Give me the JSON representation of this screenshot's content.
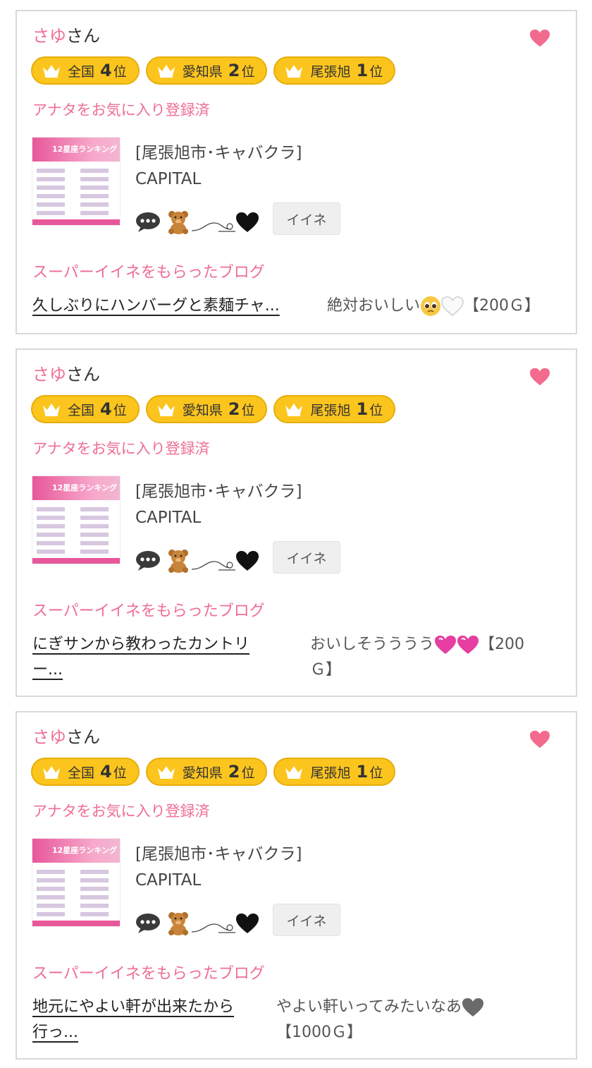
{
  "cards": [
    {
      "user_name": "さゆ",
      "honorific": "さん",
      "badges": [
        {
          "label": "全国",
          "rank": "4",
          "suffix": "位"
        },
        {
          "label": "愛知県",
          "rank": "2",
          "suffix": "位"
        },
        {
          "label": "尾張旭",
          "rank": "1",
          "suffix": "位"
        }
      ],
      "favorite_status": "アナタをお気に入り登録済",
      "thumbnail_title": "12星座ランキング",
      "shop_area": "[尾張旭市･キャバクラ]",
      "shop_name": "CAPITAL",
      "like_button": "イイネ",
      "super_like_heading": "スーパーイイネをもらったブログ",
      "blog_title": "久しぶりにハンバーグと素麺チャ...",
      "comment_text": "絶対おいしい",
      "comment_points": "【200Ｇ】"
    },
    {
      "user_name": "さゆ",
      "honorific": "さん",
      "badges": [
        {
          "label": "全国",
          "rank": "4",
          "suffix": "位"
        },
        {
          "label": "愛知県",
          "rank": "2",
          "suffix": "位"
        },
        {
          "label": "尾張旭",
          "rank": "1",
          "suffix": "位"
        }
      ],
      "favorite_status": "アナタをお気に入り登録済",
      "thumbnail_title": "12星座ランキング",
      "shop_area": "[尾張旭市･キャバクラ]",
      "shop_name": "CAPITAL",
      "like_button": "イイネ",
      "super_like_heading": "スーパーイイネをもらったブログ",
      "blog_title_line1": "にぎサンから教わったカントリ",
      "blog_title_line2": "ー...",
      "comment_text": "おいしそうううう",
      "comment_points_line1": "【200",
      "comment_points_line2": "Ｇ】"
    },
    {
      "user_name": "さゆ",
      "honorific": "さん",
      "badges": [
        {
          "label": "全国",
          "rank": "4",
          "suffix": "位"
        },
        {
          "label": "愛知県",
          "rank": "2",
          "suffix": "位"
        },
        {
          "label": "尾張旭",
          "rank": "1",
          "suffix": "位"
        }
      ],
      "favorite_status": "アナタをお気に入り登録済",
      "thumbnail_title": "12星座ランキング",
      "shop_area": "[尾張旭市･キャバクラ]",
      "shop_name": "CAPITAL",
      "like_button": "イイネ",
      "super_like_heading": "スーパーイイネをもらったブログ",
      "blog_title_line1": "地元にやよい軒が出来たから",
      "blog_title_line2": "行っ...",
      "comment_text": "やよい軒いってみたいなあ",
      "comment_points": "【1000Ｇ】"
    }
  ],
  "colors": {
    "accent_pink": "#ef6e93",
    "badge_yellow": "#fcc51e",
    "border_gray": "#d9d9d9"
  },
  "icons": [
    "heart-icon",
    "crown-icon",
    "speech-bubble-icon",
    "teddy-bear-icon",
    "black-heart-icon"
  ]
}
